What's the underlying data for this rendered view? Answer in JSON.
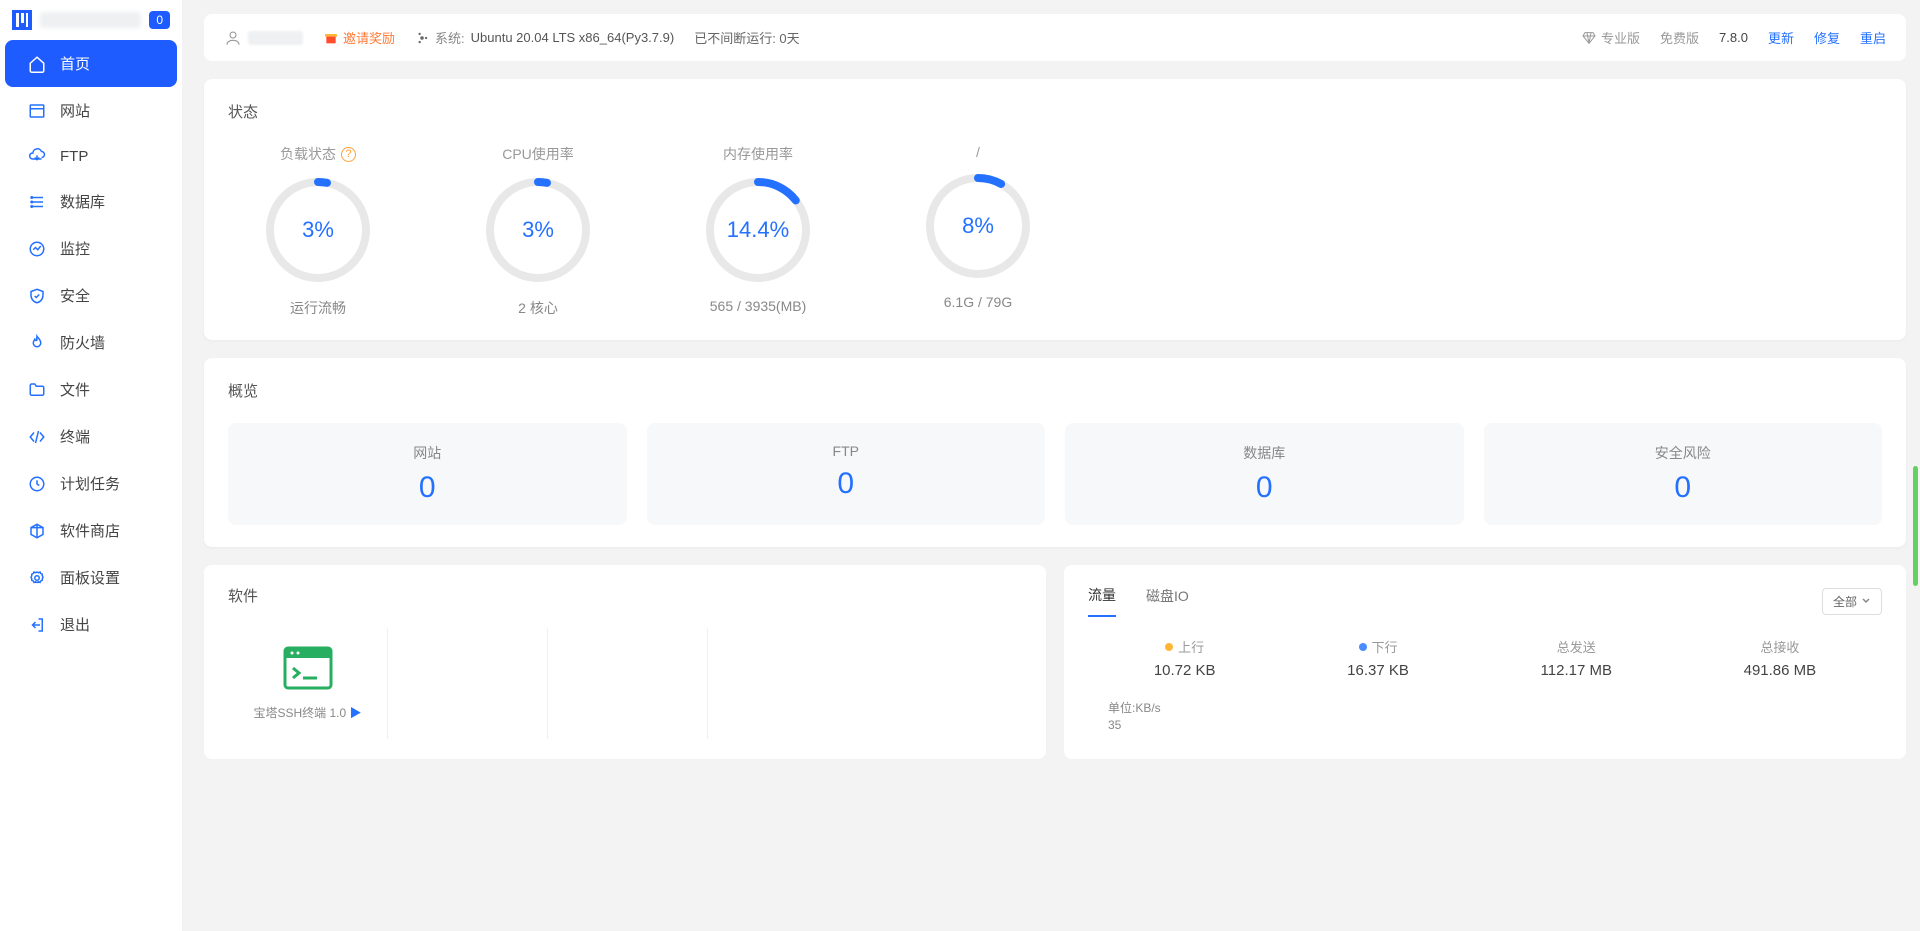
{
  "sidebar": {
    "badge": "0",
    "items": [
      {
        "label": "首页",
        "icon": "home"
      },
      {
        "label": "网站",
        "icon": "site"
      },
      {
        "label": "FTP",
        "icon": "cloud"
      },
      {
        "label": "数据库",
        "icon": "db"
      },
      {
        "label": "监控",
        "icon": "monitor"
      },
      {
        "label": "安全",
        "icon": "shield"
      },
      {
        "label": "防火墙",
        "icon": "fire"
      },
      {
        "label": "文件",
        "icon": "folder"
      },
      {
        "label": "终端",
        "icon": "code"
      },
      {
        "label": "计划任务",
        "icon": "clock"
      },
      {
        "label": "软件商店",
        "icon": "pkg"
      },
      {
        "label": "面板设置",
        "icon": "gear"
      },
      {
        "label": "退出",
        "icon": "exit"
      }
    ]
  },
  "topbar": {
    "invite": "邀请奖励",
    "systemLabel": "系统:",
    "systemValue": "Ubuntu 20.04 LTS x86_64(Py3.7.9)",
    "uptime": "已不间断运行: 0天",
    "proLabel": "专业版",
    "freeLabel": "免费版",
    "version": "7.8.0",
    "update": "更新",
    "repair": "修复",
    "restart": "重启"
  },
  "status": {
    "title": "状态",
    "gauges": [
      {
        "title": "负载状态",
        "help": true,
        "percent": 3,
        "value": "3%",
        "sub": "运行流畅"
      },
      {
        "title": "CPU使用率",
        "percent": 3,
        "value": "3%",
        "sub": "2 核心"
      },
      {
        "title": "内存使用率",
        "percent": 14.4,
        "value": "14.4%",
        "sub": "565 / 3935(MB)"
      },
      {
        "title": "/",
        "percent": 8,
        "value": "8%",
        "sub": "6.1G / 79G"
      }
    ]
  },
  "overview": {
    "title": "概览",
    "boxes": [
      {
        "label": "网站",
        "value": "0"
      },
      {
        "label": "FTP",
        "value": "0"
      },
      {
        "label": "数据库",
        "value": "0"
      },
      {
        "label": "安全风险",
        "value": "0"
      }
    ]
  },
  "software": {
    "title": "软件",
    "item": {
      "name": "宝塔SSH终端 1.0"
    }
  },
  "traffic": {
    "tabs": {
      "flow": "流量",
      "disk": "磁盘IO"
    },
    "allLabel": "全部",
    "stats": [
      {
        "label": "上行",
        "dot": "orange",
        "value": "10.72 KB"
      },
      {
        "label": "下行",
        "dot": "blue",
        "value": "16.37 KB"
      },
      {
        "label": "总发送",
        "value": "112.17 MB"
      },
      {
        "label": "总接收",
        "value": "491.86 MB"
      }
    ],
    "unit": "单位:KB/s",
    "tick": "35"
  },
  "chart_data": {
    "type": "line",
    "title": "流量",
    "ylabel": "KB/s",
    "ylim": [
      0,
      35
    ],
    "series": [
      {
        "name": "上行",
        "current": 10.72,
        "unit": "KB"
      },
      {
        "name": "下行",
        "current": 16.37,
        "unit": "KB"
      },
      {
        "name": "总发送",
        "total": 112.17,
        "unit": "MB"
      },
      {
        "name": "总接收",
        "total": 491.86,
        "unit": "MB"
      }
    ]
  }
}
